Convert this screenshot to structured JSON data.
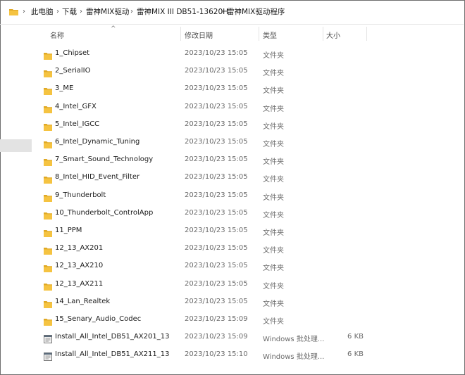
{
  "breadcrumb": [
    "此电脑",
    "下载",
    "雷神MIX驱动",
    "雷神MIX III DB51-13620H",
    "雷神MIX驱动程序"
  ],
  "columns": {
    "name": "名称",
    "date": "修改日期",
    "type": "类型",
    "size": "大小"
  },
  "colors": {
    "folder": "#f5c341",
    "folder_dark": "#e0a823"
  },
  "rows": [
    {
      "name": "1_Chipset",
      "date": "2023/10/23 15:05",
      "type": "文件夹",
      "size": "",
      "icon": "folder-icon"
    },
    {
      "name": "2_SerialIO",
      "date": "2023/10/23 15:05",
      "type": "文件夹",
      "size": "",
      "icon": "folder-icon"
    },
    {
      "name": "3_ME",
      "date": "2023/10/23 15:05",
      "type": "文件夹",
      "size": "",
      "icon": "folder-icon"
    },
    {
      "name": "4_Intel_GFX",
      "date": "2023/10/23 15:05",
      "type": "文件夹",
      "size": "",
      "icon": "folder-icon"
    },
    {
      "name": "5_Intel_IGCC",
      "date": "2023/10/23 15:05",
      "type": "文件夹",
      "size": "",
      "icon": "folder-icon"
    },
    {
      "name": "6_Intel_Dynamic_Tuning",
      "date": "2023/10/23 15:05",
      "type": "文件夹",
      "size": "",
      "icon": "folder-icon"
    },
    {
      "name": "7_Smart_Sound_Technology",
      "date": "2023/10/23 15:05",
      "type": "文件夹",
      "size": "",
      "icon": "folder-icon"
    },
    {
      "name": "8_Intel_HID_Event_Filter",
      "date": "2023/10/23 15:05",
      "type": "文件夹",
      "size": "",
      "icon": "folder-icon"
    },
    {
      "name": "9_Thunderbolt",
      "date": "2023/10/23 15:05",
      "type": "文件夹",
      "size": "",
      "icon": "folder-icon"
    },
    {
      "name": "10_Thunderbolt_ControlApp",
      "date": "2023/10/23 15:05",
      "type": "文件夹",
      "size": "",
      "icon": "folder-icon"
    },
    {
      "name": "11_PPM",
      "date": "2023/10/23 15:05",
      "type": "文件夹",
      "size": "",
      "icon": "folder-icon"
    },
    {
      "name": "12_13_AX201",
      "date": "2023/10/23 15:05",
      "type": "文件夹",
      "size": "",
      "icon": "folder-icon"
    },
    {
      "name": "12_13_AX210",
      "date": "2023/10/23 15:05",
      "type": "文件夹",
      "size": "",
      "icon": "folder-icon"
    },
    {
      "name": "12_13_AX211",
      "date": "2023/10/23 15:05",
      "type": "文件夹",
      "size": "",
      "icon": "folder-icon"
    },
    {
      "name": "14_Lan_Realtek",
      "date": "2023/10/23 15:05",
      "type": "文件夹",
      "size": "",
      "icon": "folder-icon"
    },
    {
      "name": "15_Senary_Audio_Codec",
      "date": "2023/10/23 15:09",
      "type": "文件夹",
      "size": "",
      "icon": "folder-icon"
    },
    {
      "name": "Install_All_Intel_DB51_AX201_13",
      "date": "2023/10/23 15:09",
      "type": "Windows 批处理...",
      "size": "6 KB",
      "icon": "batch-file-icon"
    },
    {
      "name": "Install_All_Intel_DB51_AX211_13",
      "date": "2023/10/23 15:10",
      "type": "Windows 批处理...",
      "size": "6 KB",
      "icon": "batch-file-icon"
    }
  ]
}
